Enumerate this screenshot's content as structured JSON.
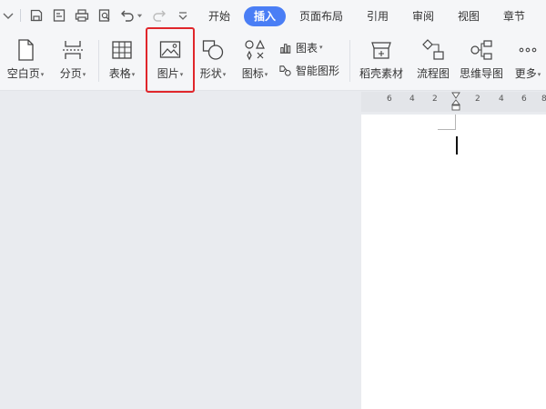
{
  "menu": {
    "tabs": [
      {
        "label": "开始"
      },
      {
        "label": "插入"
      },
      {
        "label": "页面布局"
      },
      {
        "label": "引用"
      },
      {
        "label": "审阅"
      },
      {
        "label": "视图"
      },
      {
        "label": "章节"
      }
    ],
    "active_tab_color": "#4a7ef5"
  },
  "ribbon": {
    "blank_page": "空白页",
    "page_break": "分页",
    "table": "表格",
    "picture": "图片",
    "shape": "形状",
    "icon": "图标",
    "chart": "图表",
    "smart_art": "智能图形",
    "docer_material": "稻壳素材",
    "flowchart": "流程图",
    "mind_map": "思维导图",
    "more": "更多",
    "dropdown_arrow": "▾",
    "highlight_color": "#e0262b"
  },
  "ruler": {
    "numbers": [
      "6",
      "4",
      "2",
      "2",
      "4",
      "6",
      "8"
    ]
  }
}
